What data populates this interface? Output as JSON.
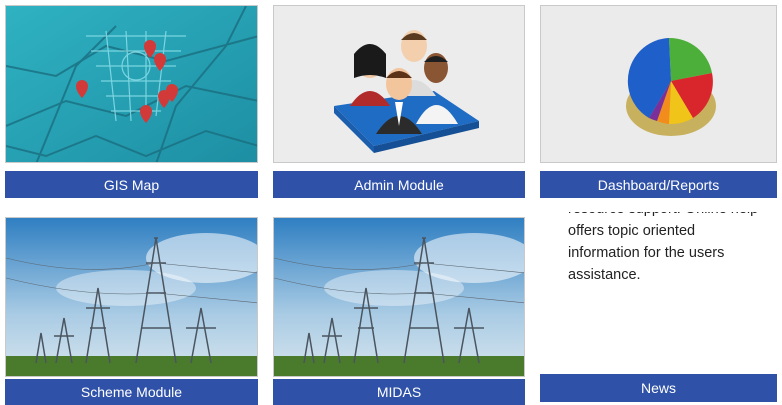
{
  "tiles": {
    "gis_map": {
      "label": "GIS Map"
    },
    "admin_module": {
      "label": "Admin Module"
    },
    "dashboard_reports": {
      "label": "Dashboard/Reports"
    },
    "scheme_module": {
      "label": "Scheme Module"
    },
    "midas": {
      "label": "MIDAS"
    },
    "news": {
      "label": "News",
      "text_line_cut": "resource support. Online help",
      "text_lines": [
        "offers topic oriented",
        "information for the users",
        "assistance."
      ]
    }
  },
  "colors": {
    "bar": "#2f52a8",
    "map": "#2ba7b8",
    "pin": "#d23a3a"
  },
  "icons": [
    "map-pin-icon",
    "users-group-icon",
    "pie-chart-icon"
  ]
}
